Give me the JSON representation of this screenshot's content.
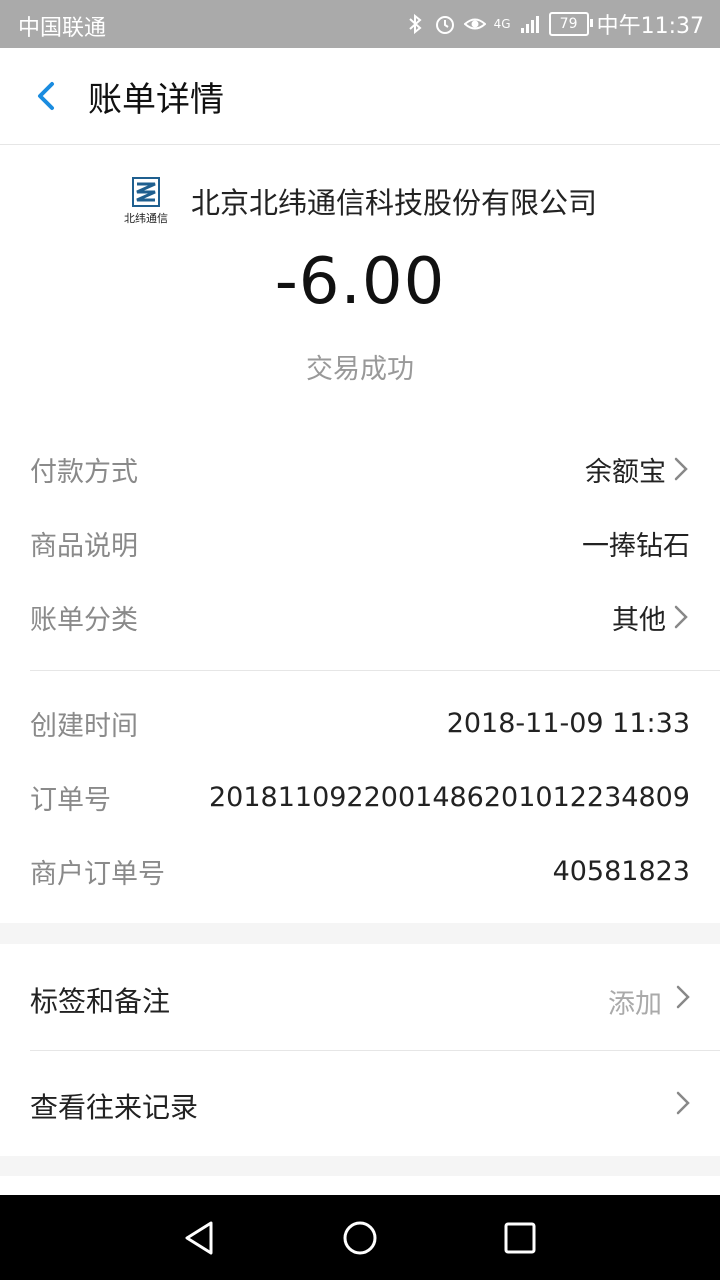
{
  "status_bar": {
    "carrier": "中国联通",
    "battery": "79",
    "time": "中午11:37",
    "network": "4G"
  },
  "header": {
    "title": "账单详情"
  },
  "merchant": {
    "name": "北京北纬通信科技股份有限公司",
    "logo_text": "北纬通信"
  },
  "transaction": {
    "amount": "-6.00",
    "status": "交易成功"
  },
  "details": [
    {
      "label": "付款方式",
      "value": "余额宝",
      "has_arrow": true
    },
    {
      "label": "商品说明",
      "value": "一捧钻石",
      "has_arrow": false
    },
    {
      "label": "账单分类",
      "value": "其他",
      "has_arrow": true
    }
  ],
  "meta": [
    {
      "label": "创建时间",
      "value": "2018-11-09 11:33"
    },
    {
      "label": "订单号",
      "value": "2018110922001486201012234809"
    },
    {
      "label": "商户订单号",
      "value": "40581823"
    }
  ],
  "actions": {
    "tags": {
      "title": "标签和备注",
      "action": "添加"
    },
    "history": {
      "title": "查看往来记录"
    }
  },
  "colors": {
    "accent": "#1a8ce0",
    "label": "#8a8a8a",
    "statusbar": "#aaaaaa"
  }
}
